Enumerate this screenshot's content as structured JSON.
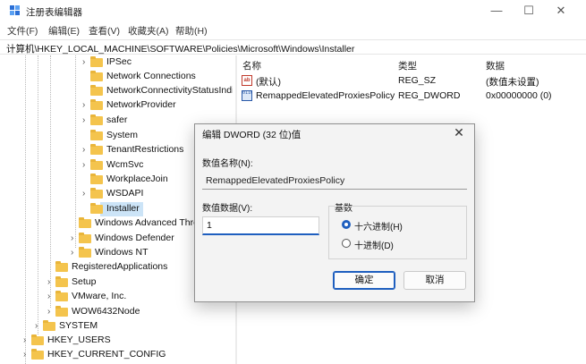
{
  "window": {
    "title": "注册表编辑器",
    "controls": {
      "minimize": "—",
      "maximize": "☐",
      "close": "✕"
    }
  },
  "menu": [
    "文件(F)",
    "编辑(E)",
    "查看(V)",
    "收藏夹(A)",
    "帮助(H)"
  ],
  "address": "计算机\\HKEY_LOCAL_MACHINE\\SOFTWARE\\Policies\\Microsoft\\Windows\\Installer",
  "tree": [
    {
      "label": "IPSec",
      "chevron": "›"
    },
    {
      "label": "Network Connections",
      "chevron": ""
    },
    {
      "label": "NetworkConnectivityStatusIndicator",
      "chevron": ""
    },
    {
      "label": "NetworkProvider",
      "chevron": "›"
    },
    {
      "label": "safer",
      "chevron": "›"
    },
    {
      "label": "System",
      "chevron": ""
    },
    {
      "label": "TenantRestrictions",
      "chevron": "›"
    },
    {
      "label": "WcmSvc",
      "chevron": "›"
    },
    {
      "label": "WorkplaceJoin",
      "chevron": ""
    },
    {
      "label": "WSDAPI",
      "chevron": "›"
    },
    {
      "label": "Installer",
      "chevron": ""
    },
    {
      "label": "Windows Advanced Threat Protection",
      "chevron": ""
    },
    {
      "label": "Windows Defender",
      "chevron": "›"
    },
    {
      "label": "Windows NT",
      "chevron": "›"
    },
    {
      "label": "RegisteredApplications",
      "chevron": ""
    },
    {
      "label": "Setup",
      "chevron": "›"
    },
    {
      "label": "VMware, Inc.",
      "chevron": "›"
    },
    {
      "label": "WOW6432Node",
      "chevron": "›"
    },
    {
      "label": "SYSTEM",
      "chevron": "›"
    },
    {
      "label": "HKEY_USERS",
      "chevron": "›"
    },
    {
      "label": "HKEY_CURRENT_CONFIG",
      "chevron": "›"
    }
  ],
  "values_table": {
    "headers": [
      "名称",
      "类型",
      "数据"
    ],
    "rows": [
      {
        "name": "(默认)",
        "type": "REG_SZ",
        "data": "(数值未设置)",
        "icon": "ab",
        "icon_name": "string-value-icon"
      },
      {
        "name": "RemappedElevatedProxiesPolicy",
        "type": "REG_DWORD",
        "data": "0x00000000 (0)",
        "icon": "0110",
        "icon_name": "dword-value-icon"
      }
    ]
  },
  "dialog": {
    "title": "编辑 DWORD (32 位)值",
    "close": "✕",
    "name_label": "数值名称(N):",
    "name_value": "RemappedElevatedProxiesPolicy",
    "data_label": "数值数据(V):",
    "data_value": "1",
    "base_label": "基数",
    "hex_label": "十六进制(H)",
    "dec_label": "十进制(D)",
    "selected_base": "hex",
    "ok_label": "确定",
    "cancel_label": "取消"
  },
  "colors": {
    "accent": "#1f5fbf",
    "folder": "#f4c44d",
    "selection": "#cce4f7"
  }
}
